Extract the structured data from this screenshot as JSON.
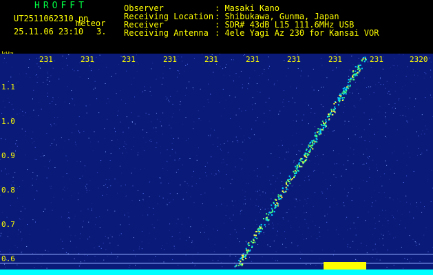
{
  "header": {
    "title": "HROFFT",
    "filename": "UT2511062310.pn",
    "filename_suffix": "meteor",
    "datetime": "25.11.06 23:10",
    "count": "3.",
    "fields": [
      {
        "label": "Observer",
        "value": ": Masaki Kano"
      },
      {
        "label": "Receiving Location",
        "value": ": Shibukawa, Gunma, Japan"
      },
      {
        "label": "Receiver",
        "value": ": SDR# 43dB L15 111.6MHz USB"
      },
      {
        "label": "Receiving Antenna",
        "value": ": 4ele Yagi Az 230 for Kansai VOR"
      }
    ]
  },
  "axis": {
    "y_unit": "kHz",
    "y_ticks": [
      "1.1",
      "1.0",
      "0.9",
      "0.8",
      "0.7",
      "0.6"
    ],
    "x_ticks": [
      "231",
      "231",
      "231",
      "231",
      "231",
      "231",
      "231",
      "231",
      "231",
      "2320"
    ]
  },
  "colors": {
    "background": "#0a1a78",
    "signal": "#00ffff",
    "burst": "#ffff00",
    "text": "#ffff00",
    "title": "#00ff44"
  }
}
